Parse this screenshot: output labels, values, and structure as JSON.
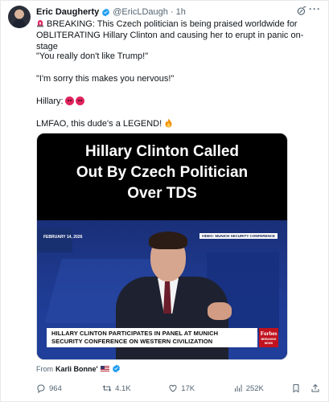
{
  "author": {
    "name": "Eric Daugherty",
    "handle": "@EricLDaugh",
    "dot": "·",
    "time": "1h"
  },
  "tweet": {
    "line1": "BREAKING: This Czech politician is being praised worldwide for OBLITERATING Hillary Clinton and causing her to erupt in panic on-stage",
    "line2": "\"You really don't like Trump!\"",
    "line3": "\"I'm sorry this makes you nervous!\"",
    "line4": "Hillary:",
    "line5": "LMFAO, this dude's a LEGEND!"
  },
  "media": {
    "title_line1": "Hillary Clinton Called",
    "title_line2": "Out By Czech Politician",
    "title_line3": "Over TDS",
    "date_label": "FEBRUARY 14, 2026",
    "video_tag": "VIDEO: MUNICH SECURITY CONFERENCE",
    "chyron_line1": "HILLARY CLINTON PARTICIPATES IN PANEL AT MUNICH",
    "chyron_line2": "SECURITY CONFERENCE ON WESTERN CIVILIZATION",
    "brand_name": "Forbes",
    "brand_sub": "BREAKING NEWS"
  },
  "source": {
    "prefix": "From",
    "name": "Karli Bonne'"
  },
  "actions": {
    "replies": "964",
    "retweets": "4.1K",
    "likes": "17K",
    "views": "252K"
  },
  "colors": {
    "verified": "#1d9bf0",
    "muted": "#536471",
    "media_blue": "#1f3c94",
    "forbes_red": "#c1121f"
  },
  "icons": [
    "verified-badge-icon",
    "grok-icon",
    "more-icon",
    "siren-icon",
    "angry-face-icon",
    "fire-icon",
    "flag-us-icon",
    "reply-icon",
    "retweet-icon",
    "like-icon",
    "views-icon",
    "bookmark-icon",
    "share-icon"
  ]
}
